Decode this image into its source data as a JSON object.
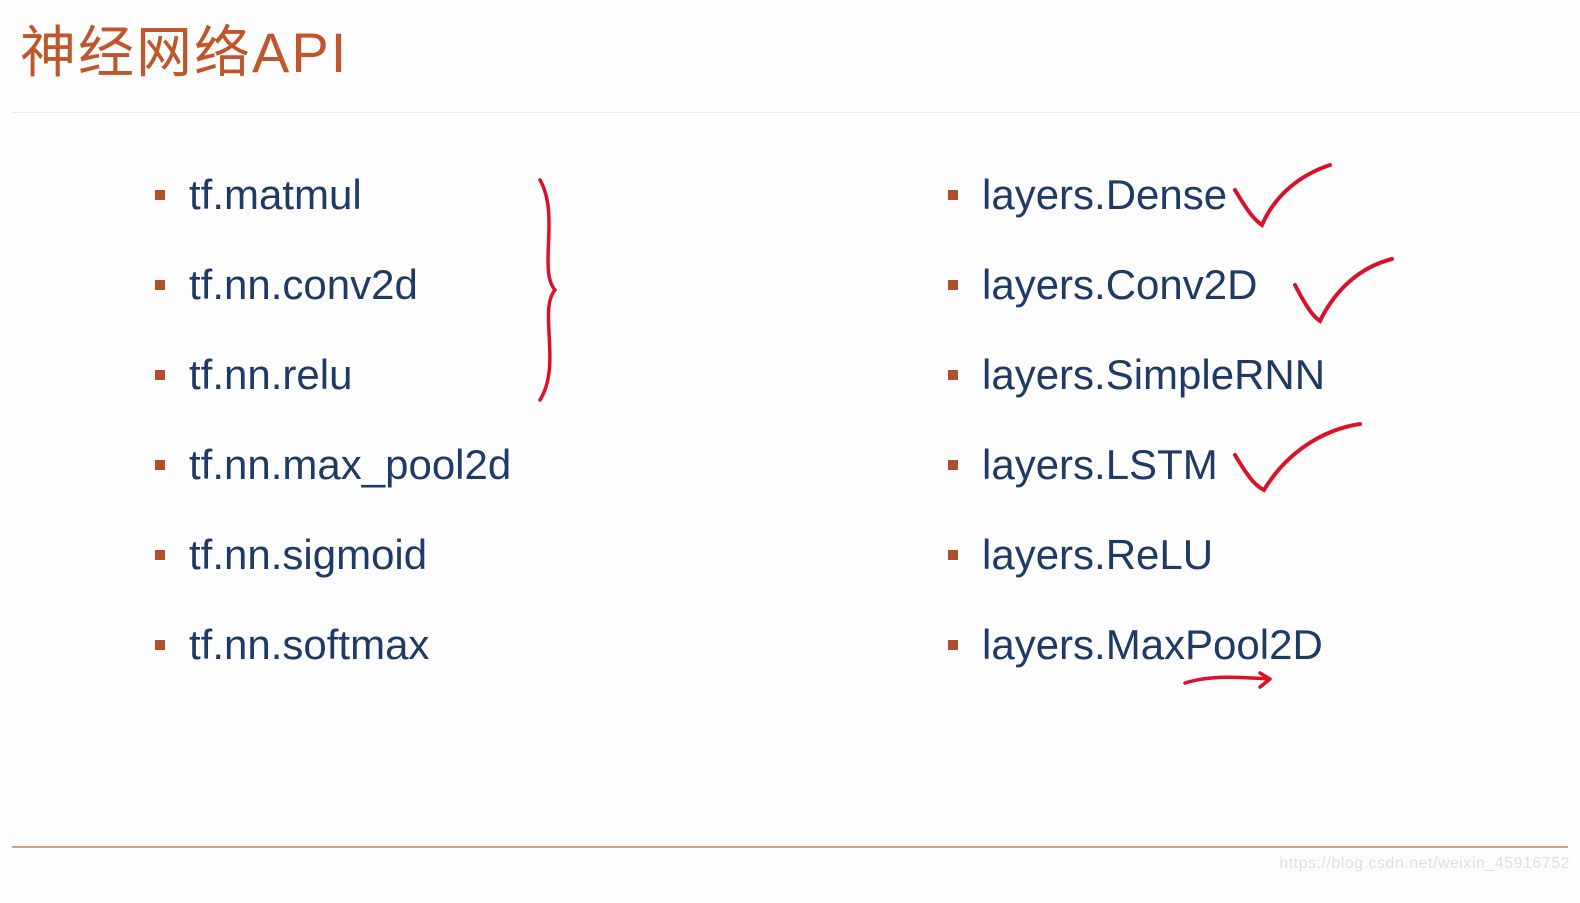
{
  "title": "神经网络API",
  "left_items": [
    "tf.matmul",
    "tf.nn.conv2d",
    "tf.nn.relu",
    "tf.nn.max_pool2d",
    "tf.nn.sigmoid",
    "tf.nn.softmax"
  ],
  "right_items": [
    "layers.Dense",
    "layers.Conv2D",
    "layers.SimpleRNN",
    "layers.LSTM",
    "layers.ReLU",
    "layers.MaxPool2D"
  ],
  "watermark": "https://blog.csdn.net/weixin_45916752",
  "colors": {
    "title": "#c0562b",
    "text": "#1e3b66",
    "bullet": "#b14f2a",
    "annotation": "#d8122a"
  }
}
